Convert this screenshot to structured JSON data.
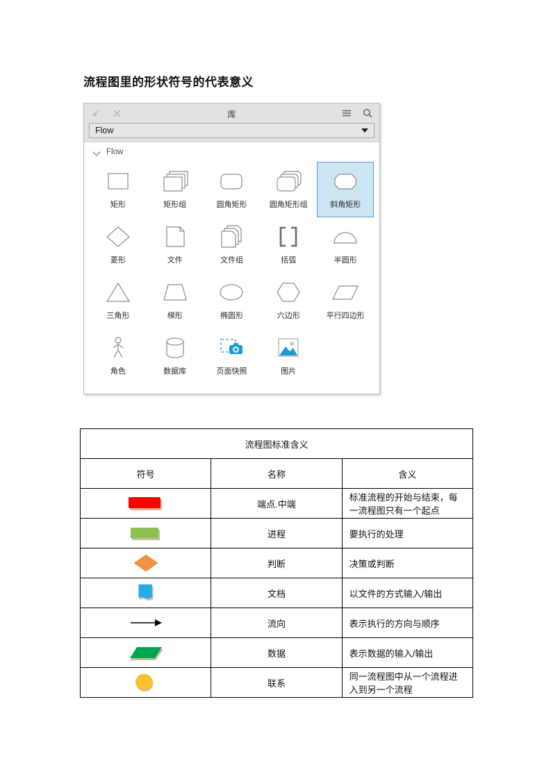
{
  "page": {
    "heading": "流程图里的形状符号的代表意义"
  },
  "library_panel": {
    "titlebar": {
      "title": "库",
      "collapse_icon": "collapse-arrow-icon",
      "close_icon": "close-icon",
      "menu_icon": "hamburger-menu-icon",
      "search_icon": "search-icon"
    },
    "library_select": {
      "value": "Flow",
      "caret_icon": "chevron-down-icon"
    },
    "group": {
      "label": "Flow",
      "chevron_icon": "chevron-down-icon",
      "expanded": true
    },
    "selected_shape": "斜角矩形",
    "selection_fill": "#cbe5f5",
    "selection_border": "#5b9bd5",
    "shape_outline_color": "#8d8d8d",
    "accent_blue": "#1e9bd7",
    "shapes": [
      {
        "label": "矩形",
        "icon": "rectangle-shape-icon",
        "selected": false
      },
      {
        "label": "矩形组",
        "icon": "rectangle-group-shape-icon",
        "selected": false
      },
      {
        "label": "圆角矩形",
        "icon": "rounded-rectangle-shape-icon",
        "selected": false
      },
      {
        "label": "圆角矩形组",
        "icon": "rounded-rectangle-group-shape-icon",
        "selected": false
      },
      {
        "label": "斜角矩形",
        "icon": "octagon-shape-icon",
        "selected": true
      },
      {
        "label": "菱形",
        "icon": "diamond-shape-icon",
        "selected": false
      },
      {
        "label": "文件",
        "icon": "document-shape-icon",
        "selected": false
      },
      {
        "label": "文件组",
        "icon": "document-group-shape-icon",
        "selected": false
      },
      {
        "label": "括弧",
        "icon": "brackets-shape-icon",
        "selected": false
      },
      {
        "label": "半圆形",
        "icon": "semicircle-shape-icon",
        "selected": false
      },
      {
        "label": "三角形",
        "icon": "triangle-shape-icon",
        "selected": false
      },
      {
        "label": "梯形",
        "icon": "trapezoid-shape-icon",
        "selected": false
      },
      {
        "label": "椭圆形",
        "icon": "ellipse-shape-icon",
        "selected": false
      },
      {
        "label": "六边形",
        "icon": "hexagon-shape-icon",
        "selected": false
      },
      {
        "label": "平行四边形",
        "icon": "parallelogram-shape-icon",
        "selected": false
      },
      {
        "label": "角色",
        "icon": "actor-person-shape-icon",
        "selected": false
      },
      {
        "label": "数据库",
        "icon": "database-cylinder-shape-icon",
        "selected": false
      },
      {
        "label": "页面快照",
        "icon": "camera-snapshot-icon",
        "selected": false
      },
      {
        "label": "图片",
        "icon": "image-placeholder-icon",
        "selected": false
      }
    ]
  },
  "meaning_table": {
    "title": "流程图标准含义",
    "headers": [
      "符号",
      "名称",
      "含义"
    ],
    "rows": [
      {
        "symbol": "rounded-rectangle-red",
        "color": "#ff0000",
        "name": "端点.中端",
        "meaning": "标准流程的开始与结束，每一流程图只有一个起点"
      },
      {
        "symbol": "rectangle-green",
        "color": "#8cc152",
        "name": "进程",
        "meaning": "要执行的处理"
      },
      {
        "symbol": "diamond-orange",
        "color": "#ef9244",
        "name": "判断",
        "meaning": "决策或判断"
      },
      {
        "symbol": "document-blue",
        "color": "#29abe2",
        "name": "文档",
        "meaning": "以文件的方式输入/输出"
      },
      {
        "symbol": "arrow-right-black",
        "color": "#000000",
        "name": "流向",
        "meaning": "表示执行的方向与顺序"
      },
      {
        "symbol": "parallelogram-green",
        "color": "#00a651",
        "name": "数据",
        "meaning": "表示数据的输入/输出"
      },
      {
        "symbol": "circle-yellow",
        "color": "#fbc02d",
        "name": "联系",
        "meaning": "同一流程图中从一个流程进入到另一个流程"
      }
    ]
  }
}
